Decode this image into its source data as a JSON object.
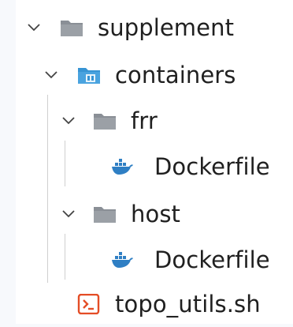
{
  "explorer": {
    "items": [
      {
        "label": "supplement",
        "icon": "folder-icon",
        "expanded": true
      },
      {
        "label": "containers",
        "icon": "folder-container-icon",
        "expanded": true
      },
      {
        "label": "frr",
        "icon": "folder-icon",
        "expanded": true
      },
      {
        "label": "Dockerfile",
        "icon": "docker-icon"
      },
      {
        "label": "host",
        "icon": "folder-icon",
        "expanded": true
      },
      {
        "label": "Dockerfile",
        "icon": "docker-icon"
      },
      {
        "label": "topo_utils.sh",
        "icon": "shell-script-icon"
      }
    ]
  },
  "colors": {
    "folder": "#8a8f96",
    "container_folder": "#3794d4",
    "docker": "#2f7fc4",
    "shell": "#e44d26",
    "guide": "#cfcfcf"
  }
}
